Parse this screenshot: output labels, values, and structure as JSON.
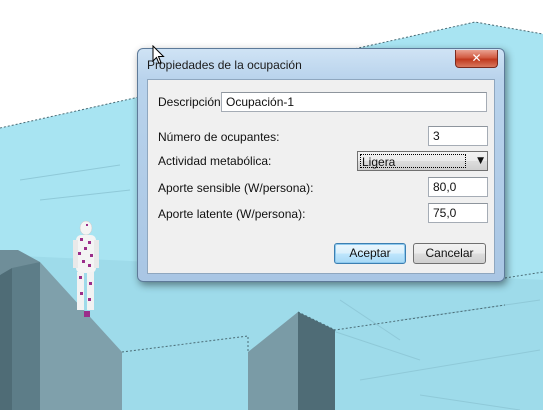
{
  "dialog": {
    "title": "Propiedades de la ocupación",
    "close_glyph": "✕",
    "fields": {
      "descripcion": {
        "label": "Descripción:",
        "value": "Ocupación-1"
      },
      "numero_ocupantes": {
        "label": "Número de ocupantes:",
        "value": "3"
      },
      "actividad_metabolica": {
        "label": "Actividad metabólica:",
        "value": "Ligera"
      },
      "aporte_sensible": {
        "label": "Aporte sensible (W/persona):",
        "value": "80,0"
      },
      "aporte_latente": {
        "label": "Aporte latente (W/persona):",
        "value": "75,0"
      }
    },
    "buttons": {
      "accept": "Aceptar",
      "cancel": "Cancelar"
    }
  },
  "colors": {
    "floor_top": "#a8e4f2",
    "wall_dark": "#5d7d88",
    "wall_mid": "#7a9ba6",
    "window_frame": "#b9d3ec",
    "client_bg": "#f0f0f0",
    "close_red": "#c03a1f"
  },
  "icons": {
    "close": "close-icon",
    "dropdown": "chevron-down-icon",
    "cursor": "mouse-pointer-icon"
  }
}
